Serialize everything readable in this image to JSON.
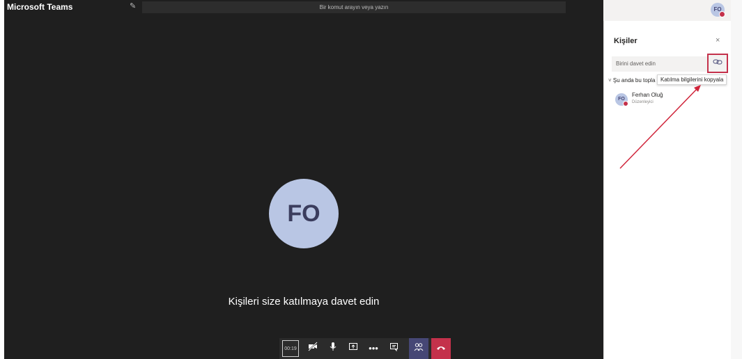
{
  "app": {
    "title": "Microsoft Teams"
  },
  "search": {
    "placeholder": "Bir komut arayın veya yazın"
  },
  "me": {
    "initials": "FO"
  },
  "stage": {
    "avatar_initials": "FO",
    "invite_text": "Kişileri size katılmaya davet edin"
  },
  "callbar": {
    "timer": "00:19",
    "more": "•••"
  },
  "panel": {
    "title": "Kişiler",
    "close": "×",
    "invite_placeholder": "Birini davet edin",
    "section_label": "Şu anda bu topla",
    "tooltip": "Katılma bilgilerini kopyala",
    "participant": {
      "initials": "FO",
      "name": "Ferhan Oluğ",
      "role": "Düzenleyici"
    }
  },
  "colors": {
    "accent": "#464775",
    "hangup": "#c4314b",
    "annotation": "#d0243a"
  }
}
